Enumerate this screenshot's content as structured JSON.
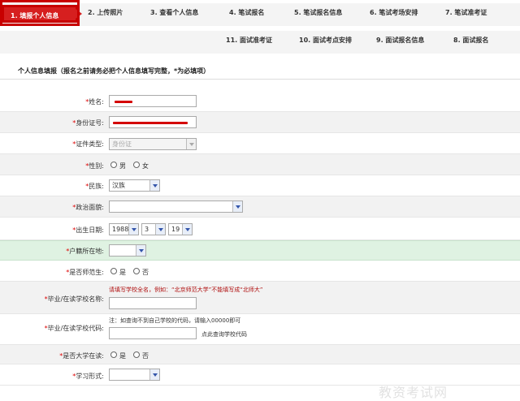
{
  "nav": {
    "row1": [
      "1. 填报个人信息",
      "2. 上传照片",
      "3. 查看个人信息",
      "4. 笔试报名",
      "5. 笔试报名信息",
      "6. 笔试考场安排",
      "7. 笔试准考证"
    ],
    "row2": [
      "11. 面试准考证",
      "10. 面试考点安排",
      "9. 面试报名信息",
      "8. 面试报名"
    ]
  },
  "section_title": "个人信息填报（报名之前请务必把个人信息填写完整，*为必填项）",
  "form": {
    "name_label": "姓名:",
    "id_label": "身份证号:",
    "idtype_label": "证件类型:",
    "idtype_value": "身份证",
    "gender_label": "性别:",
    "gender_options": [
      "男",
      "女"
    ],
    "ethnic_label": "民族:",
    "ethnic_value": "汉族",
    "political_label": "政治面貌:",
    "birth_label": "出生日期:",
    "birth_year": "1988",
    "birth_month": "3",
    "birth_day": "19",
    "hukou_label": "户籍所在地:",
    "normal_label": "是否师范生:",
    "yes_no": [
      "是",
      "否"
    ],
    "school_name_label": "毕业/在读学校名称:",
    "school_name_hint": "请填写学校全名，例如：“北京师范大学”不能填写成“北师大”",
    "school_code_label": "毕业/在读学校代码:",
    "school_code_note": "注：如查询不到自己学校的代码，请输入00000即可",
    "school_code_link": "点此查询学校代码",
    "college_label": "是否大学在读:",
    "study_form_label": "学习形式:"
  },
  "watermark": "教资考试网"
}
